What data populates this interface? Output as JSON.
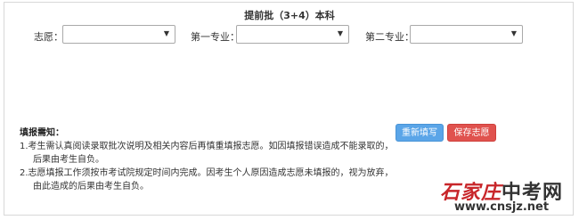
{
  "form": {
    "title": "提前批（3+4）本科",
    "fields": [
      {
        "label": "志愿：",
        "value": "",
        "arrow": "▼"
      },
      {
        "label": "第一专业：",
        "value": "",
        "arrow": "▼"
      },
      {
        "label": "第二专业：",
        "value": "",
        "arrow": "▼"
      }
    ]
  },
  "notice": {
    "title": "填报需知：",
    "lines": [
      "1.考生需认真阅读录取批次说明及相关内容后再慎重填报志愿。如因填报错误造成不能录取的，",
      "后果由考生自负。",
      "2.志愿填报工作须按市考试院规定时间内完成。因考生个人原因造成志愿未填报的，视为放弃，",
      "由此造成的后果由考生自负。"
    ]
  },
  "buttons": {
    "reset_label": "重新填写",
    "save_label": "保存志愿"
  },
  "watermark": {
    "brand_red": "石家庄",
    "brand_dark": "中考网",
    "url": "www.cnsjz.net"
  },
  "colors": {
    "reset_button": "#5aa5e8",
    "save_button": "#e0524e",
    "watermark_red": "#c8262a"
  }
}
